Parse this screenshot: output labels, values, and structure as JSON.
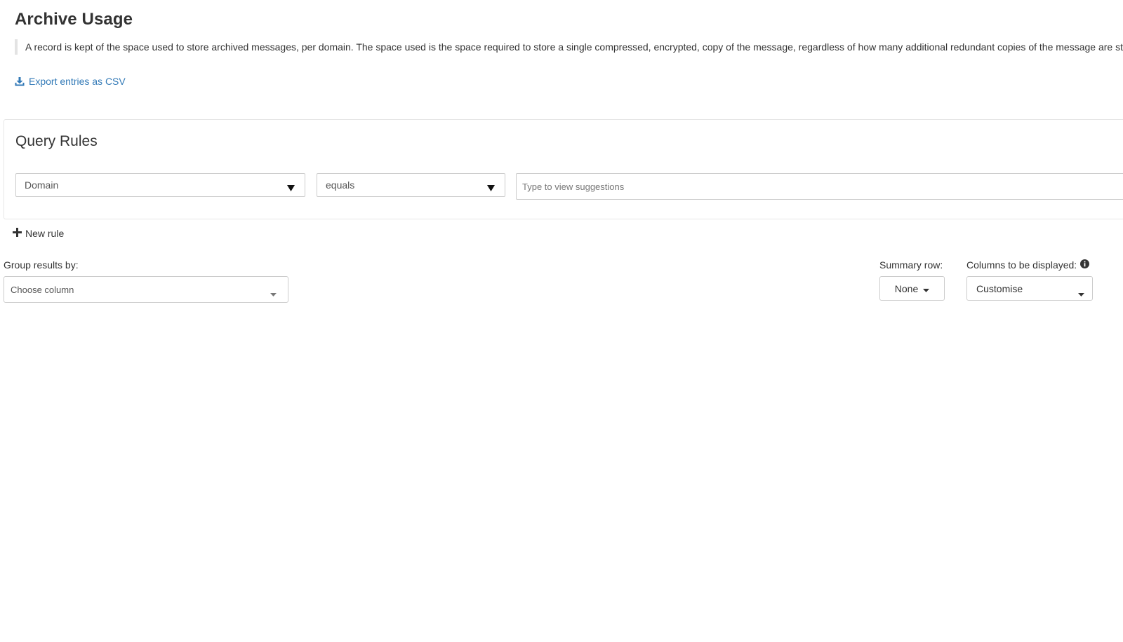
{
  "header": {
    "title": "Archive Usage",
    "description": "A record is kept of the space used to store archived messages, per domain. The space used is the space required to store a single compressed, encrypted, copy of the message, regardless of how many additional redundant copies of the message are stored."
  },
  "export": {
    "label": "Export entries as CSV",
    "icon": "download-icon"
  },
  "query": {
    "title": "Query Rules",
    "field_select": {
      "value": "Domain"
    },
    "operator_select": {
      "value": "equals"
    },
    "value_input": {
      "value": "",
      "placeholder": "Type to view suggestions"
    },
    "new_rule_label": "New rule"
  },
  "group": {
    "label": "Group results by:",
    "placeholder": "Choose column"
  },
  "summary": {
    "label": "Summary row:",
    "value": "None"
  },
  "columns": {
    "label": "Columns to be displayed:",
    "value": "Customise",
    "info_icon": "info-circle-icon"
  },
  "colors": {
    "link": "#337ab7",
    "text": "#333333",
    "border": "#cccccc",
    "quote_bar": "#e3e3e3"
  }
}
